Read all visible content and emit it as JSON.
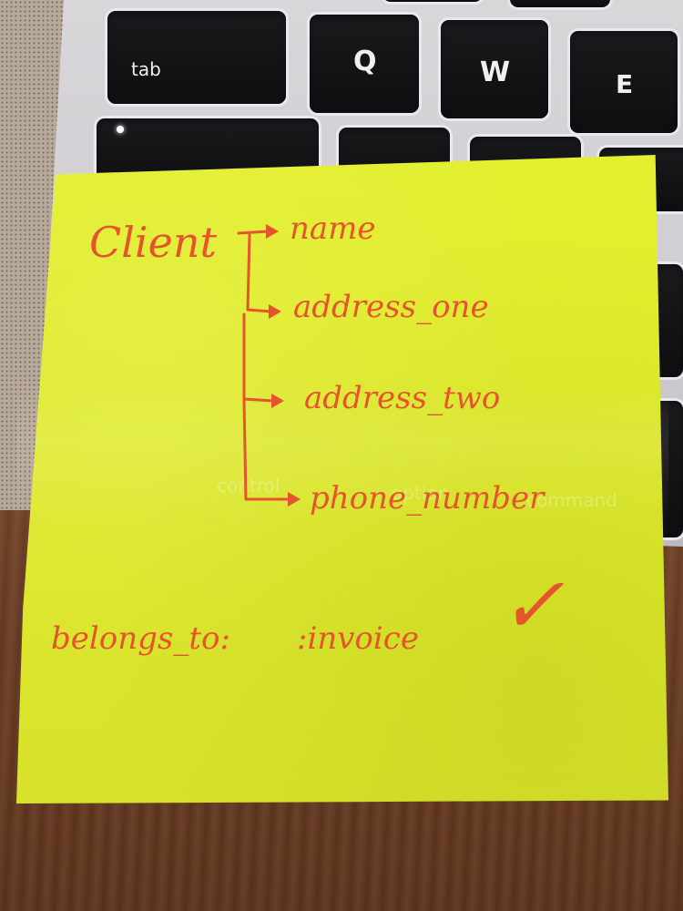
{
  "keyboard": {
    "tab_label": "tab",
    "q_label": "Q",
    "w_label": "W",
    "e_label": "E",
    "ghost_control": "control",
    "ghost_option": "option",
    "ghost_command": "command"
  },
  "note": {
    "root": "Client",
    "attributes": [
      "name",
      "address_one",
      "address_two",
      "phone_number"
    ],
    "relation": "belongs_to:",
    "relation_target": ":invoice",
    "checkmark": "✓"
  },
  "colors": {
    "ink": "#e5542d",
    "note": "#dfea2b",
    "key": "#111113"
  }
}
